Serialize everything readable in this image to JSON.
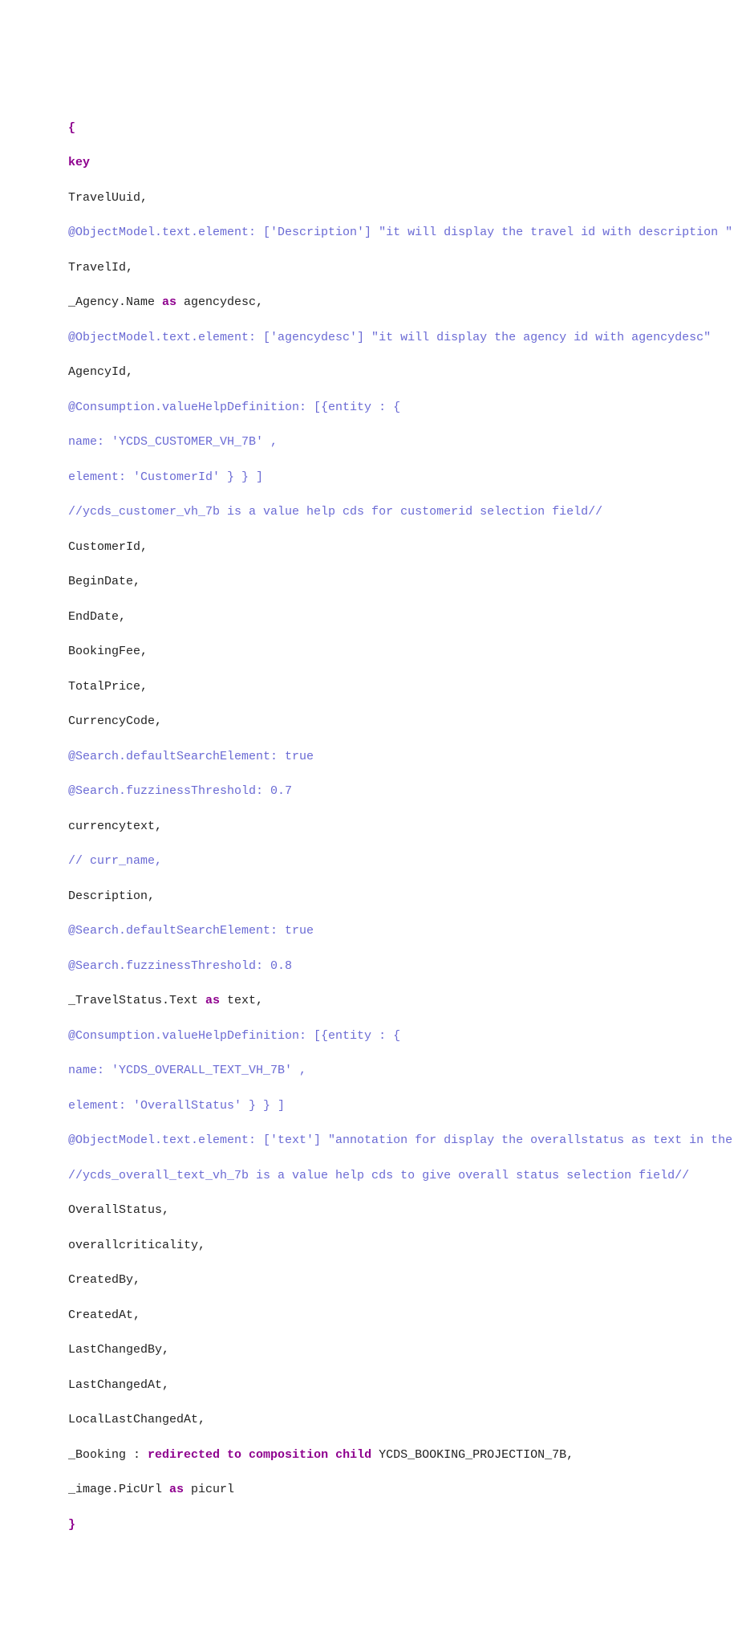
{
  "lines": {
    "l00": "{",
    "l01": "key",
    "l02": "TravelUuid,",
    "l03": "@ObjectModel.text.element: ['Description'] \"it will display the travel id with description \"",
    "l04": "TravelId,",
    "l05a": "_Agency.Name ",
    "l05b": "as",
    "l05c": " agencydesc,",
    "l06": "@ObjectModel.text.element: ['agencydesc'] \"it will display the agency id with agencydesc\"",
    "l07": "AgencyId,",
    "l08": "@Consumption.valueHelpDefinition: [{entity : {",
    "l09": "name: 'YCDS_CUSTOMER_VH_7B' ,",
    "l10": "element: 'CustomerId' } } ]",
    "l11": "//ycds_customer_vh_7b is a value help cds for customerid selection field//",
    "l12": "CustomerId,",
    "l13": "BeginDate,",
    "l14": "EndDate,",
    "l15": "BookingFee,",
    "l16": "TotalPrice,",
    "l17": "CurrencyCode,",
    "l18": "@Search.defaultSearchElement: true",
    "l19": "@Search.fuzzinessThreshold: 0.7",
    "l20": "currencytext,",
    "l21": "// curr_name,",
    "l22": "Description,",
    "l23": "@Search.defaultSearchElement: true",
    "l24": "@Search.fuzzinessThreshold: 0.8",
    "l25a": "_TravelStatus.Text ",
    "l25b": "as",
    "l25c": " text,",
    "l26": "@Consumption.valueHelpDefinition: [{entity : {",
    "l27": "name: 'YCDS_OVERALL_TEXT_VH_7B' ,",
    "l28": "element: 'OverallStatus' } } ]",
    "l29": "@ObjectModel.text.element: ['text'] \"annotation for display the overallstatus as text in the output screen \"",
    "l30": "//ycds_overall_text_vh_7b is a value help cds to give overall status selection field//",
    "l31": "OverallStatus,",
    "l32": "overallcriticality,",
    "l33": "CreatedBy,",
    "l34": "CreatedAt,",
    "l35": "LastChangedBy,",
    "l36": "LastChangedAt,",
    "l37": "LocalLastChangedAt,",
    "l38a": "_Booking : ",
    "l38b": "redirected to composition child",
    "l38c": " YCDS_BOOKING_PROJECTION_7B,",
    "l39a": "_image.PicUrl ",
    "l39b": "as",
    "l39c": " picurl",
    "l40": "}"
  }
}
